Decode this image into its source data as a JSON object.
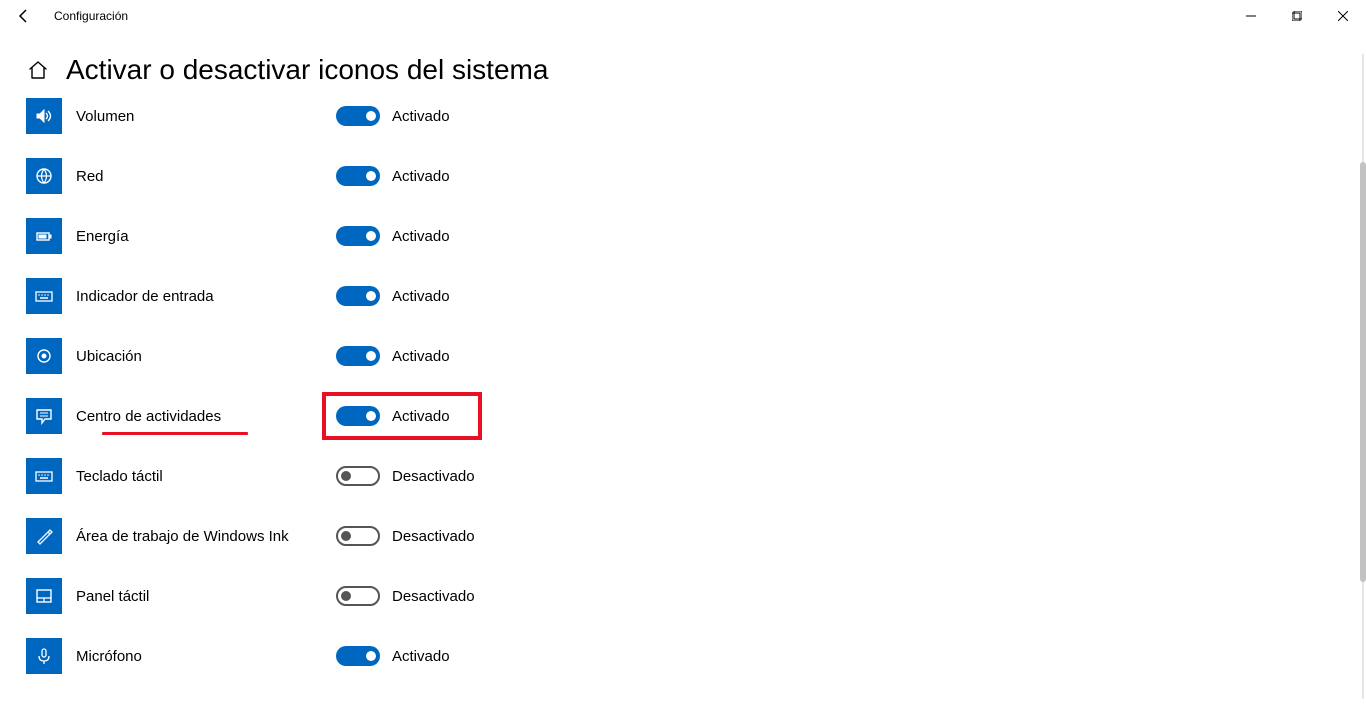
{
  "app": {
    "title": "Configuración"
  },
  "page": {
    "title": "Activar o desactivar iconos del sistema"
  },
  "status": {
    "on": "Activado",
    "off": "Desactivado"
  },
  "items": [
    {
      "id": "volumen",
      "label": "Volumen",
      "on": true
    },
    {
      "id": "red",
      "label": "Red",
      "on": true
    },
    {
      "id": "energia",
      "label": "Energía",
      "on": true
    },
    {
      "id": "entrada",
      "label": "Indicador de entrada",
      "on": true
    },
    {
      "id": "ubicacion",
      "label": "Ubicación",
      "on": true
    },
    {
      "id": "centro",
      "label": "Centro de actividades",
      "on": true
    },
    {
      "id": "teclado",
      "label": "Teclado táctil",
      "on": false
    },
    {
      "id": "ink",
      "label": "Área de trabajo de Windows Ink",
      "on": false
    },
    {
      "id": "panel",
      "label": "Panel táctil",
      "on": false
    },
    {
      "id": "microfono",
      "label": "Micrófono",
      "on": true
    }
  ],
  "highlight": {
    "index": 5
  },
  "colors": {
    "accent": "#0067c0",
    "annotation": "#e81123"
  }
}
